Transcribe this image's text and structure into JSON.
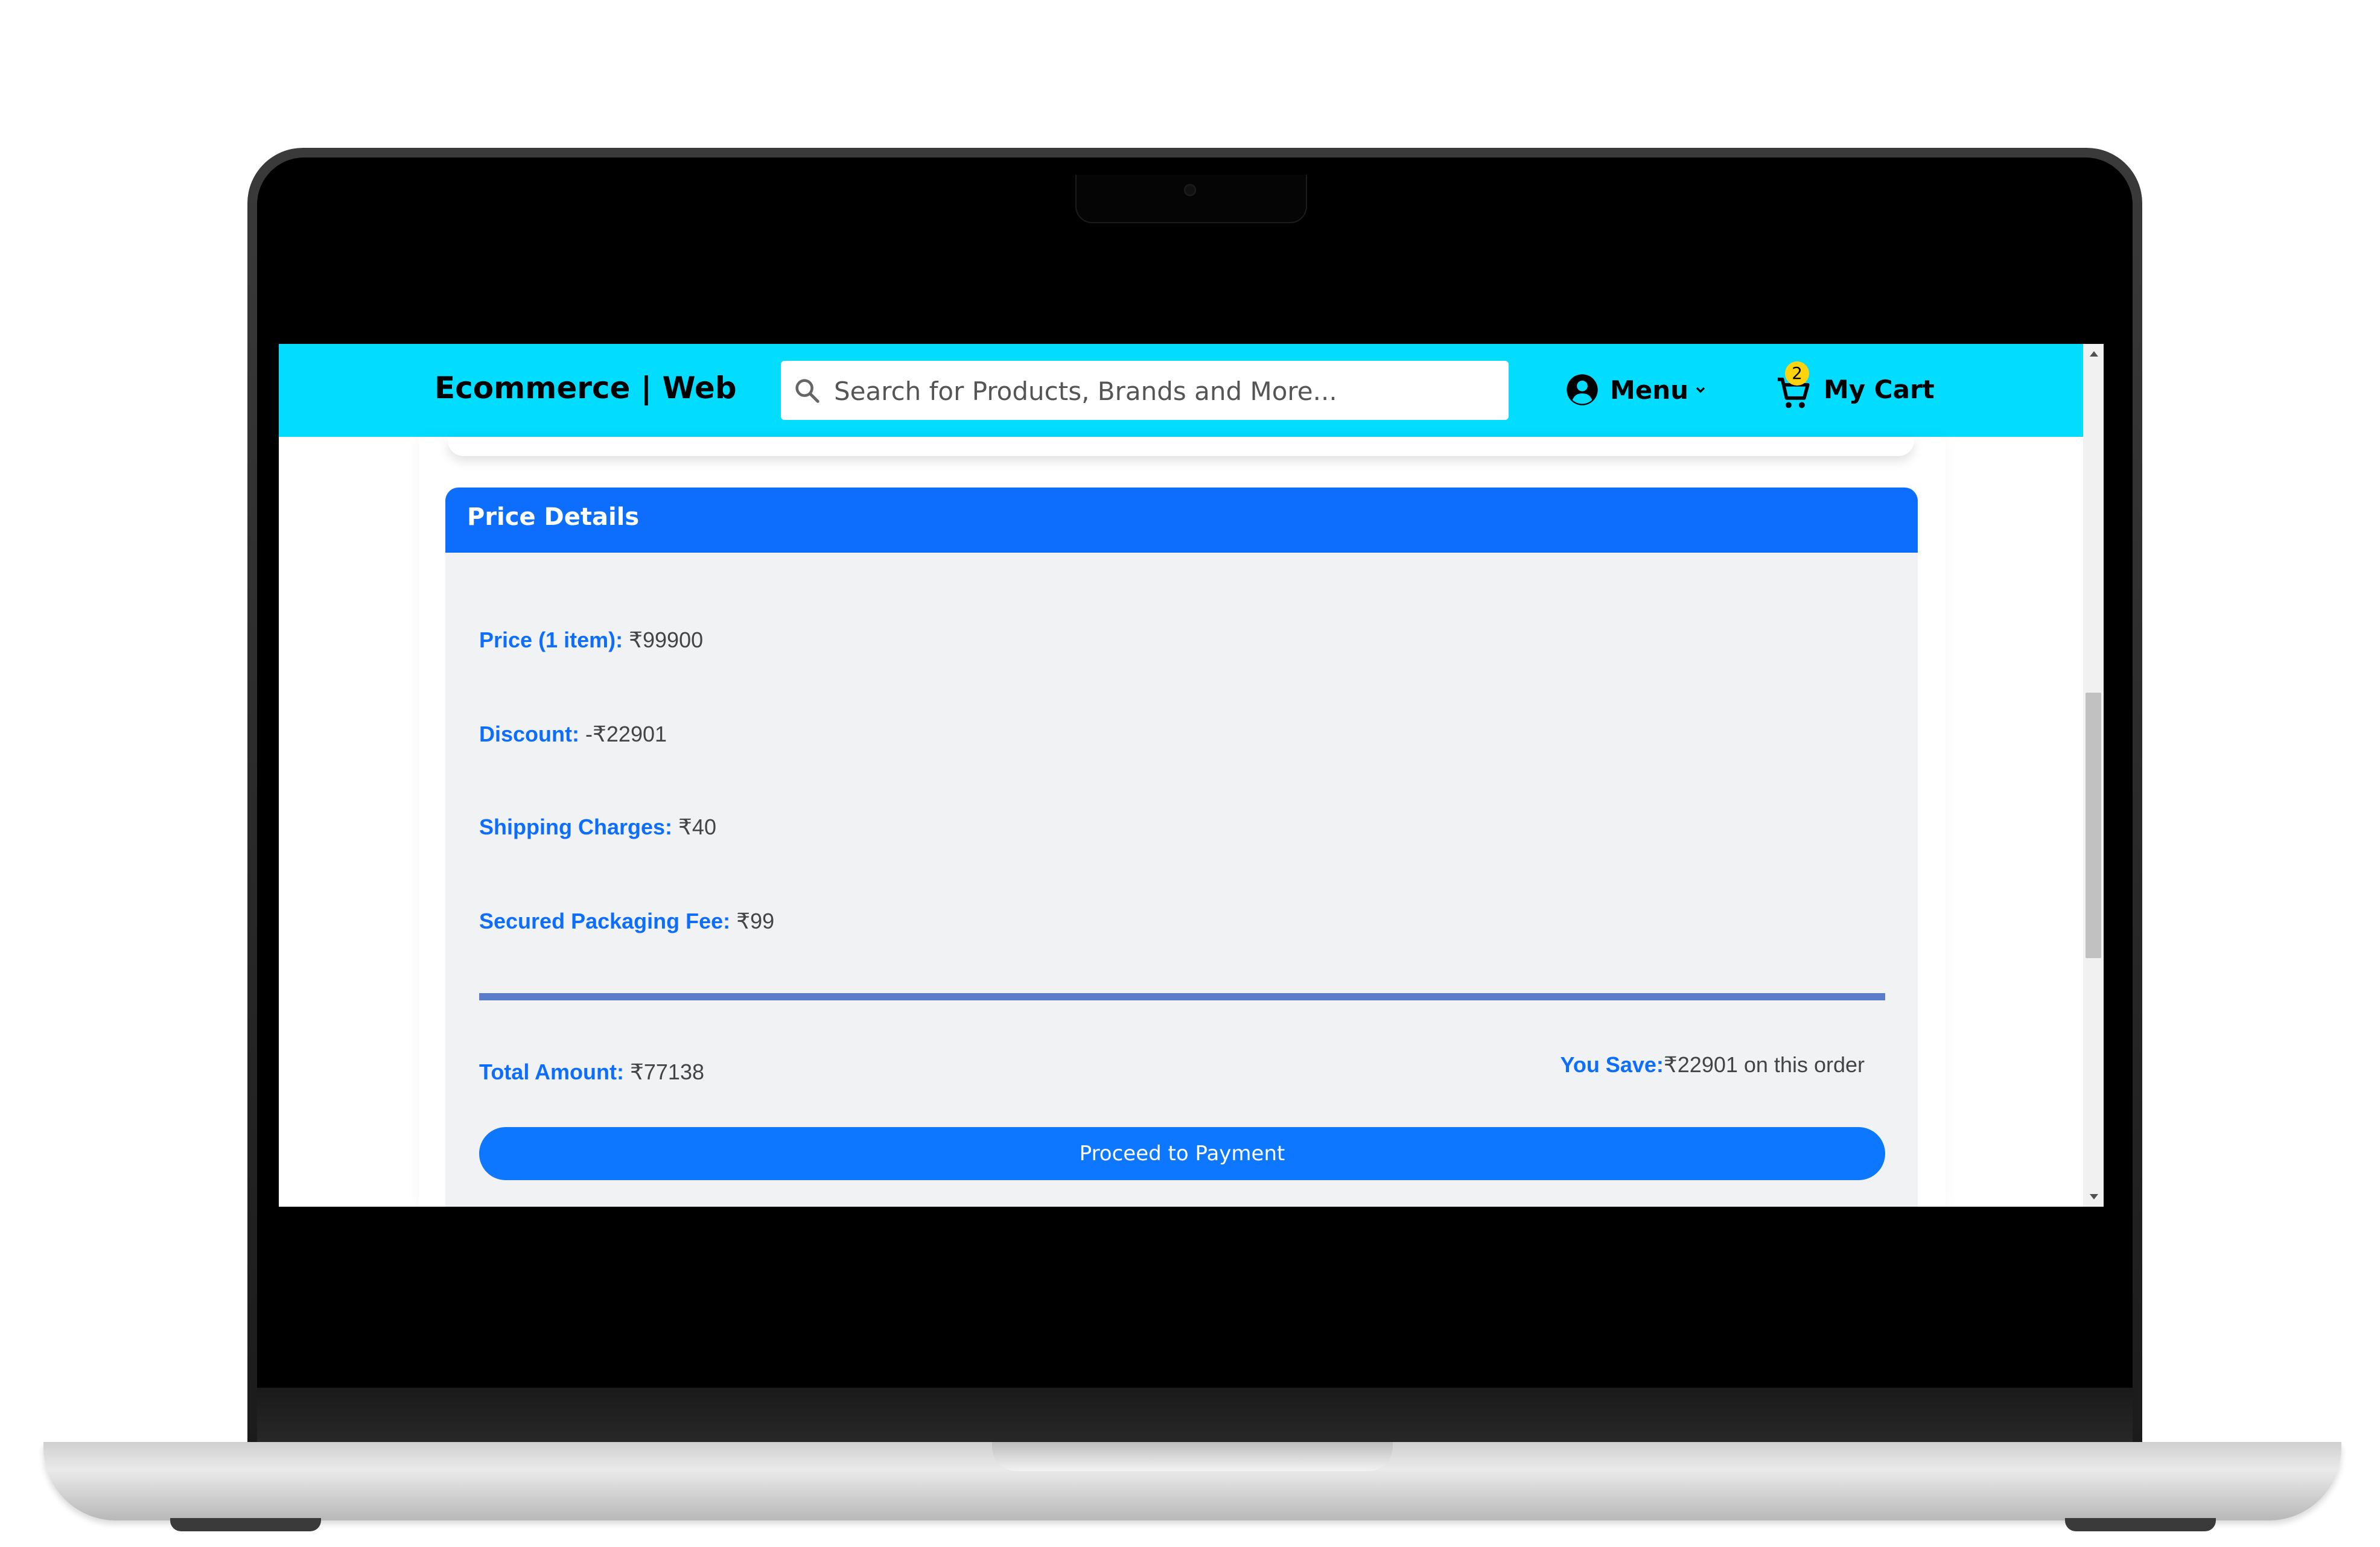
{
  "navbar": {
    "brand": "Ecommerce | Web",
    "search_placeholder": "Search for Products, Brands and More...",
    "menu_label": "Menu",
    "cart_label": "My Cart",
    "cart_count": "2"
  },
  "price_details": {
    "title": "Price Details",
    "rows": [
      {
        "label": "Price (1 item):",
        "value": "₹99900"
      },
      {
        "label": "Discount:",
        "value": "-₹22901"
      },
      {
        "label": "Shipping Charges:",
        "value": "₹40"
      },
      {
        "label": "Secured Packaging Fee:",
        "value": "₹99"
      }
    ],
    "total": {
      "label": "Total Amount:",
      "value": "₹77138"
    },
    "savings": {
      "label": "You Save:",
      "value": "₹22901 on this order"
    },
    "pay_button": "Proceed to Payment"
  },
  "colors": {
    "navbar_bg": "#02dcff",
    "header_blue": "#0d6efd",
    "button_blue": "#0d78ff",
    "badge_yellow": "#ffd30d",
    "card_bg": "#f1f2f4",
    "divider": "#5a7cc9"
  },
  "icons": [
    "search-icon",
    "user-circle-icon",
    "chevron-down-icon",
    "cart-icon"
  ]
}
